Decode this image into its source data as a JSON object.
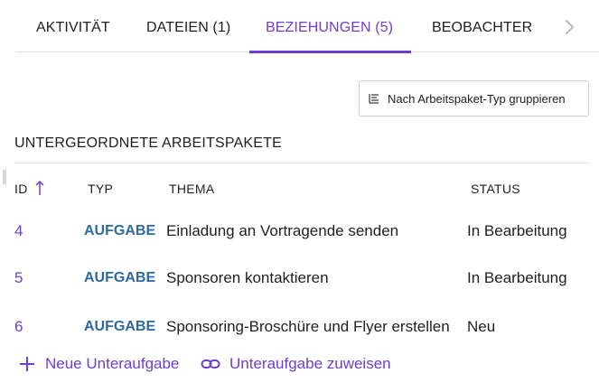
{
  "tabs": [
    {
      "label": "AKTIVITÄT"
    },
    {
      "label": "DATEIEN (1)"
    },
    {
      "label": "BEZIEHUNGEN (5)"
    },
    {
      "label": "BEOBACHTER"
    }
  ],
  "tabs_next_icon": "chevron-right-icon",
  "group_button": {
    "label": "Nach Arbeitspaket-Typ gruppieren",
    "icon": "group-list-icon"
  },
  "section": {
    "title": "UNTERGEORDNETE ARBEITSPAKETE"
  },
  "table": {
    "columns": [
      "ID",
      "TYP",
      "THEMA",
      "STATUS"
    ],
    "sort_icon": "arrow-up-icon",
    "rows": [
      {
        "id": "4",
        "type": "AUFGABE",
        "subject": "Einladung an Vortragende senden",
        "status": "In Bearbeitung"
      },
      {
        "id": "5",
        "type": "AUFGABE",
        "subject": "Sponsoren kontaktieren",
        "status": "In Bearbeitung"
      },
      {
        "id": "6",
        "type": "AUFGABE",
        "subject": "Sponsoring-Broschüre und Flyer erstellen",
        "status": "Neu"
      }
    ]
  },
  "actions": {
    "new_child": {
      "label": "Neue Unteraufgabe",
      "icon": "plus-icon"
    },
    "assign_child": {
      "label": "Unteraufgabe zuweisen",
      "icon": "link-icon"
    }
  },
  "colors": {
    "accent": "#6b3fd3",
    "type_color": "#2d6a9f",
    "border": "#e0e0e0"
  }
}
